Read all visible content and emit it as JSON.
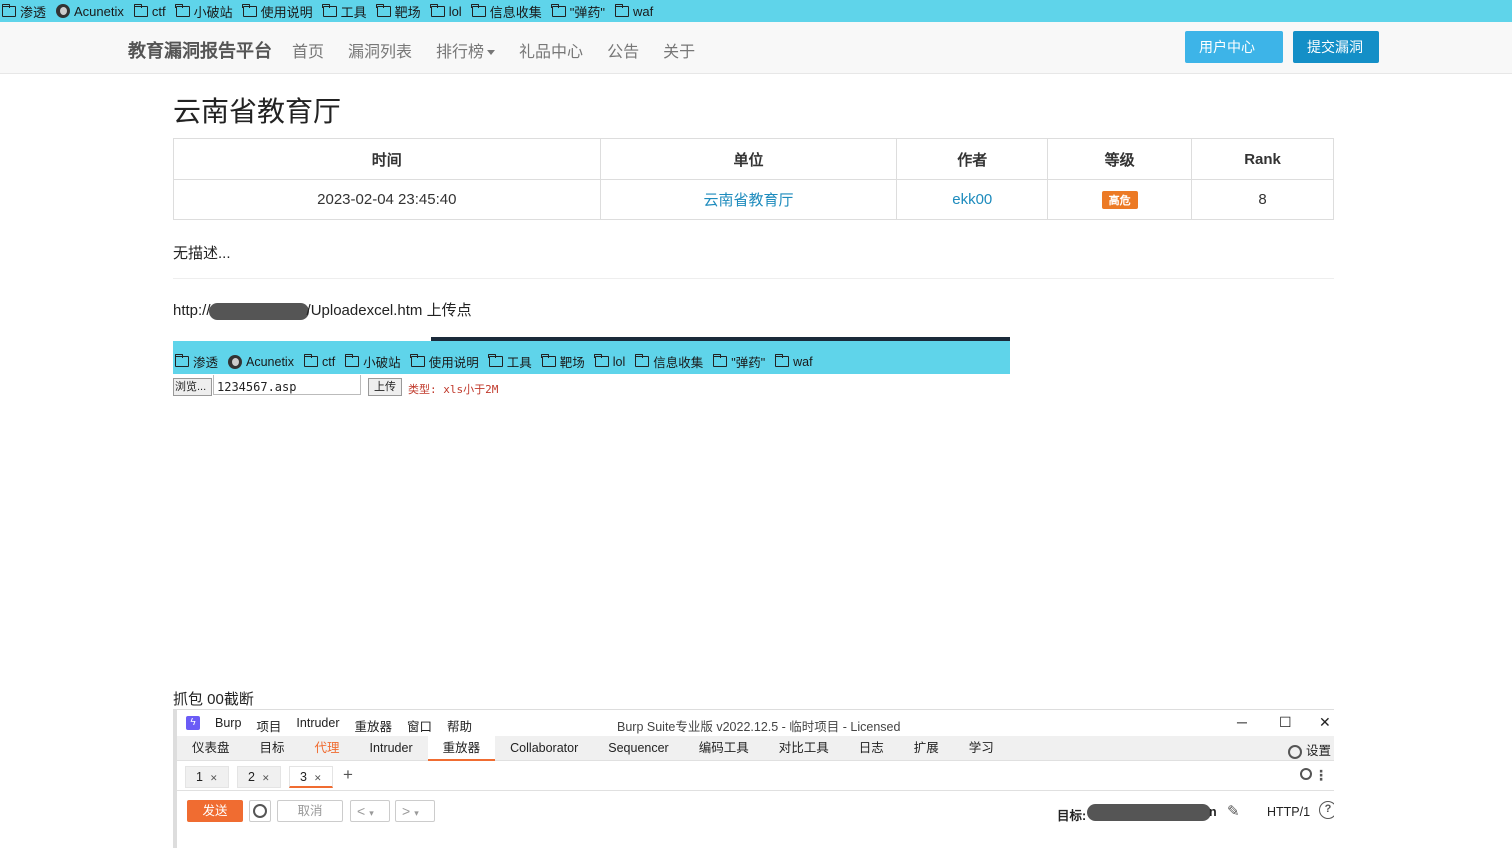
{
  "bookmarks": [
    {
      "icon": "folder-icon",
      "label": "渗透"
    },
    {
      "icon": "acunetix-icon",
      "label": "Acunetix"
    },
    {
      "icon": "folder-icon",
      "label": "ctf"
    },
    {
      "icon": "folder-icon",
      "label": "小破站"
    },
    {
      "icon": "folder-icon",
      "label": "使用说明"
    },
    {
      "icon": "folder-icon",
      "label": "工具"
    },
    {
      "icon": "folder-icon",
      "label": "靶场"
    },
    {
      "icon": "folder-icon",
      "label": "lol"
    },
    {
      "icon": "folder-icon",
      "label": "信息收集"
    },
    {
      "icon": "folder-icon",
      "label": "\"弹药\""
    },
    {
      "icon": "folder-icon",
      "label": "waf"
    }
  ],
  "navbar": {
    "brand": "教育漏洞报告平台",
    "links": [
      "首页",
      "漏洞列表",
      "排行榜",
      "礼品中心",
      "公告",
      "关于"
    ],
    "user_center": "用户中心",
    "submit": "提交漏洞"
  },
  "report": {
    "title": "云南省教育厅",
    "columns": [
      "时间",
      "单位",
      "作者",
      "等级",
      "Rank"
    ],
    "row": {
      "time": "2023-02-04 23:45:40",
      "unit": "云南省教育厅",
      "author": "ekk00",
      "level": "高危",
      "rank": "8"
    },
    "description": "无描述...",
    "url_prefix": "http://",
    "url_suffix": "/Uploadexcel.htm 上传点"
  },
  "upload_shot": {
    "browse": "浏览...",
    "filename": "1234567.asp",
    "upload": "上传",
    "type_hint": "类型: xls小于2M"
  },
  "caption2": "抓包 00截断",
  "burp": {
    "menu": [
      "Burp",
      "项目",
      "Intruder",
      "重放器",
      "窗口",
      "帮助"
    ],
    "title": "Burp Suite专业版  v2022.12.5 - 临时项目 - Licensed",
    "tabs": [
      "仪表盘",
      "目标",
      "代理",
      "Intruder",
      "重放器",
      "Collaborator",
      "Sequencer",
      "编码工具",
      "对比工具",
      "日志",
      "扩展",
      "学习"
    ],
    "settings": "设置",
    "subtabs": [
      "1",
      "2",
      "3"
    ],
    "send": "发送",
    "cancel": "取消",
    "target_label": "目标:",
    "target_tail": "n",
    "http": "HTTP/1",
    "accent": "#f06c31"
  }
}
